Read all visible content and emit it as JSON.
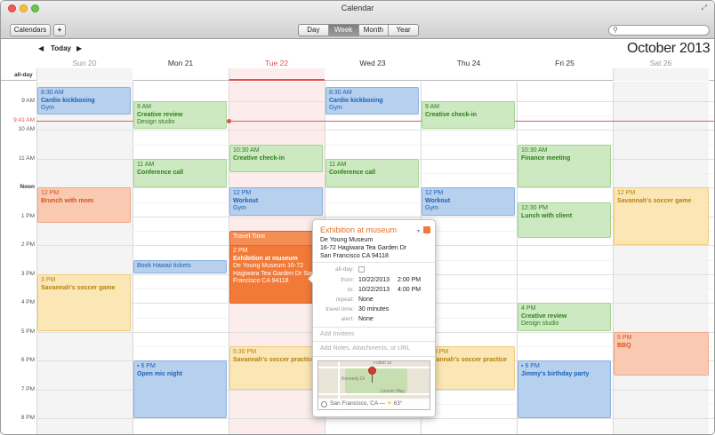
{
  "window": {
    "title": "Calendar"
  },
  "toolbar": {
    "calendars_label": "Calendars",
    "add_label": "+",
    "views": [
      "Day",
      "Week",
      "Month",
      "Year"
    ],
    "active_view": "Week",
    "search_icon": "search-icon"
  },
  "nav": {
    "prev": "◀",
    "today_label": "Today",
    "next": "▶",
    "month": "October",
    "year": "2013"
  },
  "days": [
    {
      "label": "Sun 20"
    },
    {
      "label": "Mon 21"
    },
    {
      "label": "Tue 22"
    },
    {
      "label": "Wed 23"
    },
    {
      "label": "Thu 24"
    },
    {
      "label": "Fri 25"
    },
    {
      "label": "Sat 26"
    }
  ],
  "allday_label": "all-day",
  "times": [
    "9 AM",
    "10 AM",
    "11 AM",
    "Noon",
    "1 PM",
    "2 PM",
    "3 PM",
    "4 PM",
    "5 PM",
    "6 PM",
    "7 PM",
    "8 PM"
  ],
  "now_label": "9:41 AM",
  "events": {
    "sun_cardio": {
      "time": "8:30 AM",
      "name": "Cardio kickboxing",
      "loc": "Gym"
    },
    "sun_brunch": {
      "time": "12 PM",
      "name": "Brunch with mom"
    },
    "sun_soccer": {
      "time": "3 PM",
      "name": "Savannah's soccer game"
    },
    "mon_review": {
      "time": "9 AM",
      "name": "Creative review",
      "loc": "Design studio"
    },
    "mon_conf": {
      "time": "11 AM",
      "name": "Conference call"
    },
    "mon_hawaii": {
      "name": "Book Hawaii tickets"
    },
    "mon_openmic": {
      "time": "6 PM",
      "name": "Open mic night"
    },
    "tue_checkin": {
      "time": "10:30 AM",
      "name": "Creative check-in"
    },
    "tue_workout": {
      "time": "12 PM",
      "name": "Workout",
      "loc": "Gym"
    },
    "tue_travel": {
      "name": "Travel Time"
    },
    "tue_museum": {
      "time": "2 PM",
      "name": "Exhibition at museum",
      "loc": "De Young Museum 16-72 Hagiwara Tea Garden Dr San Francisco CA 94118"
    },
    "tue_soccer": {
      "time": "5:30 PM",
      "name": "Savannah's soccer practice"
    },
    "wed_cardio": {
      "time": "8:30 AM",
      "name": "Cardio kickboxing",
      "loc": "Gym"
    },
    "wed_conf": {
      "time": "11 AM",
      "name": "Conference call"
    },
    "thu_checkin": {
      "time": "9 AM",
      "name": "Creative check-in"
    },
    "thu_workout": {
      "time": "12 PM",
      "name": "Workout",
      "loc": "Gym"
    },
    "thu_soccer": {
      "time": "5:30 PM",
      "name": "Savannah's soccer practice"
    },
    "fri_finance": {
      "time": "10:30 AM",
      "name": "Finance meeting"
    },
    "fri_lunch": {
      "time": "12:30 PM",
      "name": "Lunch with client"
    },
    "fri_review": {
      "time": "4 PM",
      "name": "Creative review",
      "loc": "Design studio"
    },
    "fri_bday": {
      "time": "6 PM",
      "name": "Jimmy's birthday party"
    },
    "sat_soccer": {
      "time": "12 PM",
      "name": "Savannah's soccer game"
    },
    "sat_bbq": {
      "time": "5 PM",
      "name": "BBQ"
    }
  },
  "popover": {
    "title": "Exhibition at museum",
    "address": [
      "De Young Museum",
      "16-72 Hagiwara Tea Garden Dr",
      "San Francisco CA 94118"
    ],
    "allday_label": "all-day:",
    "from_label": "from:",
    "from_date": "10/22/2013",
    "from_time": "2:00 PM",
    "to_label": "to:",
    "to_date": "10/22/2013",
    "to_time": "4:00 PM",
    "repeat_label": "repeat:",
    "repeat_value": "None",
    "travel_label": "travel time:",
    "travel_value": "30 minutes",
    "alert_label": "alert:",
    "alert_value": "None",
    "invitees_placeholder": "Add Invitees",
    "notes_placeholder": "Add Notes, Attachments, or URL",
    "map_caption": "San Francisco, CA —",
    "weather": "63°",
    "map_labels": [
      "Fulton St",
      "Kennedy Dr",
      "Lincoln Way"
    ]
  },
  "colors": {
    "blue": "#b6d0ee",
    "green": "#cde9c2",
    "orange": "#f9c9b1",
    "yellow": "#fbe6b5",
    "deep_orange": "#f27a38",
    "today": "#e0524a"
  }
}
